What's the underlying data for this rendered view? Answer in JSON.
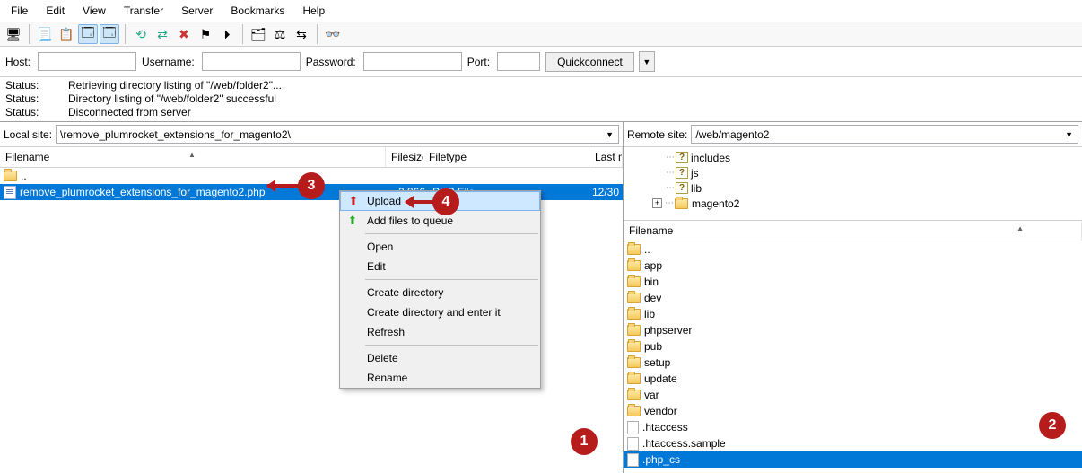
{
  "menu": {
    "items": [
      "File",
      "Edit",
      "View",
      "Transfer",
      "Server",
      "Bookmarks",
      "Help"
    ]
  },
  "quick": {
    "host_label": "Host:",
    "user_label": "Username:",
    "pass_label": "Password:",
    "port_label": "Port:",
    "connect": "Quickconnect"
  },
  "status": {
    "label": "Status:",
    "lines": [
      "Retrieving directory listing of \"/web/folder2\"...",
      "Directory listing of \"/web/folder2\" successful",
      "Disconnected from server"
    ]
  },
  "local": {
    "site_label": "Local site:",
    "path": "\\remove_plumrocket_extensions_for_magento2\\",
    "cols": {
      "name": "Filename",
      "size": "Filesize",
      "type": "Filetype",
      "mod": "Last m"
    },
    "up": "..",
    "file": {
      "name": "remove_plumrocket_extensions_for_magento2.php",
      "size": "2.866",
      "type": "PHP File",
      "mod": "12/30"
    }
  },
  "remote": {
    "site_label": "Remote site:",
    "path": "/web/magento2",
    "tree": [
      "includes",
      "js",
      "lib",
      "magento2"
    ],
    "col_name": "Filename",
    "up": "..",
    "folders": [
      "app",
      "bin",
      "dev",
      "lib",
      "phpserver",
      "pub",
      "setup",
      "update",
      "var",
      "vendor"
    ],
    "files": [
      ".htaccess",
      ".htaccess.sample",
      ".php_cs"
    ]
  },
  "context": {
    "upload": "Upload",
    "queue": "Add files to queue",
    "open": "Open",
    "edit": "Edit",
    "mkdir": "Create directory",
    "mkdircd": "Create directory and enter it",
    "refresh": "Refresh",
    "delete": "Delete",
    "rename": "Rename"
  },
  "callouts": {
    "c1": "1",
    "c2": "2",
    "c3": "3",
    "c4": "4"
  }
}
